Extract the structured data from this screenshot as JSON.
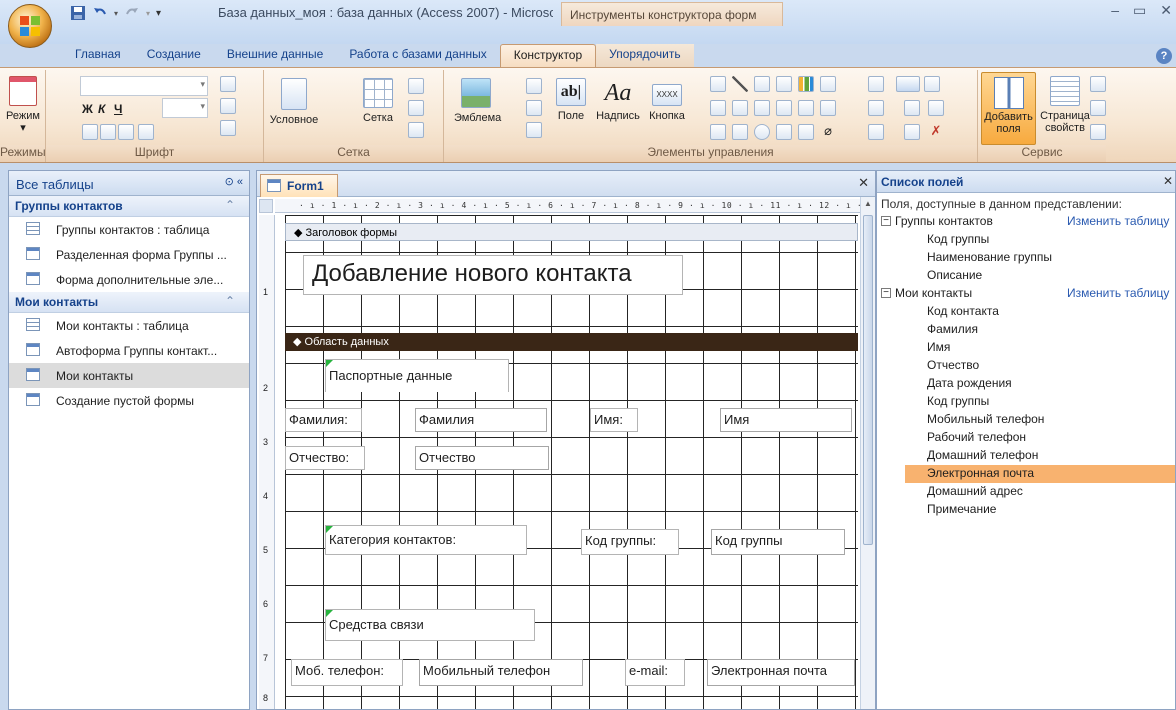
{
  "titlebar": {
    "window_title": "База данных_моя : база данных (Access 2007) - Microsoft Access",
    "context_title": "Инструменты конструктора форм",
    "minimize": "–",
    "restore": "▭",
    "close": "✕"
  },
  "tabs": [
    {
      "label": "Главная"
    },
    {
      "label": "Создание"
    },
    {
      "label": "Внешние данные"
    },
    {
      "label": "Работа с базами данных"
    },
    {
      "label": "Конструктор"
    },
    {
      "label": "Упорядочить"
    }
  ],
  "ribbon": {
    "mode_label": "Режим",
    "conditional_label": "Условное",
    "grid_label": "Сетка",
    "logo_label": "Эмблема",
    "field_label": "Поле",
    "caption_label": "Надпись",
    "button_label": "Кнопка",
    "textbox_glyph": "ab|",
    "label_glyph": "Aa",
    "button_glyph": "XXXX",
    "add_fields_label": "Добавить поля",
    "property_sheet_label": "Страница свойств",
    "groups": {
      "modes": "Режимы",
      "font": "Шрифт",
      "grid": "Сетка",
      "controls": "Элементы управления",
      "tools": "Сервис"
    }
  },
  "nav": {
    "header": "Все таблицы",
    "groups": [
      {
        "title": "Группы контактов",
        "items": [
          {
            "label": "Группы контактов : таблица",
            "type": "table"
          },
          {
            "label": "Разделенная форма Группы ...",
            "type": "form"
          },
          {
            "label": "Форма дополнительные эле...",
            "type": "form"
          }
        ]
      },
      {
        "title": "Мои контакты",
        "items": [
          {
            "label": "Мои контакты : таблица",
            "type": "table"
          },
          {
            "label": "Автоформа Группы контакт...",
            "type": "form"
          },
          {
            "label": "Мои контакты",
            "type": "form",
            "selected": true
          },
          {
            "label": "Создание пустой формы",
            "type": "form"
          }
        ]
      }
    ]
  },
  "document": {
    "tab_label": "Form1",
    "ruler": "· ı · 1 · ı · 2 · ı · 3 · ı · 4 · ı · 5 · ı · 6 · ı · 7 · ı · 8 · ı · 9 · ı · 10 · ı · 11 · ı · 12 · ı · 13 ·",
    "vruler_numbers": [
      "1",
      "2",
      "3",
      "4",
      "5",
      "6",
      "7",
      "8"
    ],
    "form_header_section": "Заголовок формы",
    "detail_section": "Область данных",
    "title_label": "Добавление нового контакта",
    "controls": {
      "passport_label": "Паспортные данные",
      "lastname_label": "Фамилия:",
      "lastname_field": "Фамилия",
      "firstname_label": "Имя:",
      "firstname_field": "Имя",
      "patronymic_label": "Отчество:",
      "patronymic_field": "Отчество",
      "category_label": "Категория контактов:",
      "groupcode_label": "Код группы:",
      "groupcode_field": "Код группы",
      "comm_label": "Средства связи",
      "mobile_label": "Моб. телефон:",
      "mobile_field": "Мобильный телефон",
      "email_label": "e-mail:",
      "email_field": "Электронная почта"
    }
  },
  "field_list": {
    "header": "Список полей",
    "subtitle": "Поля, доступные в данном представлении:",
    "edit_table_label": "Изменить таблицу",
    "tables": [
      {
        "name": "Группы контактов",
        "fields": [
          "Код группы",
          "Наименование группы",
          "Описание"
        ]
      },
      {
        "name": "Мои контакты",
        "fields": [
          "Код контакта",
          "Фамилия",
          "Имя",
          "Отчество",
          "Дата рождения",
          "Код группы",
          "Мобильный телефон",
          "Рабочий телефон",
          "Домашний телефон",
          "Электронная почта",
          "Домашний адрес",
          "Примечание"
        ],
        "selected_field": "Электронная почта"
      }
    ]
  },
  "colors": {
    "ribbon_accent": "#f7aa3f",
    "detail_bar": "#3a2616",
    "selected_field": "#f8b26f",
    "control_mark": "#27b33d"
  }
}
